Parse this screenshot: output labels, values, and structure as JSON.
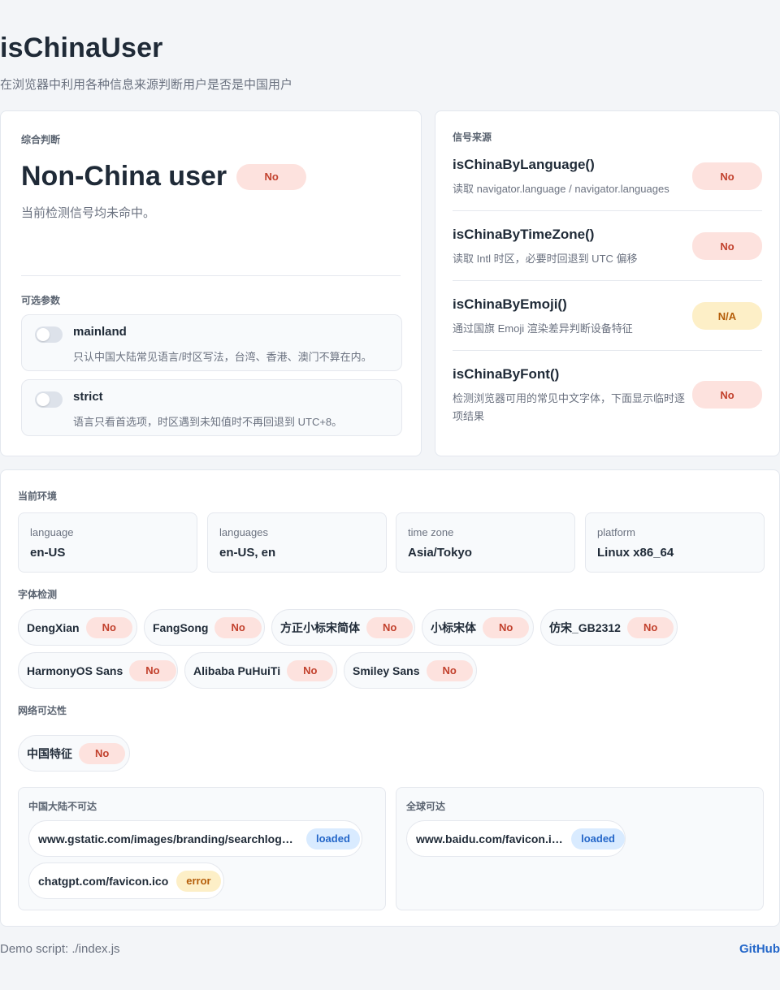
{
  "header": {
    "title": "isChinaUser",
    "subtitle": "在浏览器中利用各种信息来源判断用户是否是中国用户"
  },
  "verdict": {
    "section_title": "综合判断",
    "title": "Non-China user",
    "badge": "No",
    "description": "当前检测信号均未命中。",
    "options_title": "可选参数",
    "options": [
      {
        "name": "mainland",
        "enabled": false,
        "description": "只认中国大陆常见语言/时区写法，台湾、香港、澳门不算在内。"
      },
      {
        "name": "strict",
        "enabled": false,
        "description": "语言只看首选项，时区遇到未知值时不再回退到 UTC+8。"
      }
    ]
  },
  "signals": {
    "section_title": "信号来源",
    "items": [
      {
        "name": "isChinaByLanguage()",
        "description": "读取 navigator.language / navigator.languages",
        "badge": "No"
      },
      {
        "name": "isChinaByTimeZone()",
        "description": "读取 Intl 时区，必要时回退到 UTC 偏移",
        "badge": "No"
      },
      {
        "name": "isChinaByEmoji()",
        "description": "通过国旗 Emoji 渲染差异判断设备特征",
        "badge": "N/A"
      },
      {
        "name": "isChinaByFont()",
        "description": "检测浏览器可用的常见中文字体，下面显示临时逐项结果",
        "badge": "No"
      }
    ]
  },
  "environment": {
    "section_title": "当前环境",
    "fields": [
      {
        "key": "language",
        "value": "en-US"
      },
      {
        "key": "languages",
        "value": "en-US, en"
      },
      {
        "key": "time zone",
        "value": "Asia/Tokyo"
      },
      {
        "key": "platform",
        "value": "Linux x86_64"
      }
    ],
    "fonts_title": "字体检测",
    "fonts": [
      {
        "name": "DengXian",
        "badge": "No"
      },
      {
        "name": "FangSong",
        "badge": "No"
      },
      {
        "name": "方正小标宋简体",
        "badge": "No"
      },
      {
        "name": "小标宋体",
        "badge": "No"
      },
      {
        "name": "仿宋_GB2312",
        "badge": "No"
      },
      {
        "name": "HarmonyOS Sans",
        "badge": "No"
      },
      {
        "name": "Alibaba PuHuiTi",
        "badge": "No"
      },
      {
        "name": "Smiley Sans",
        "badge": "No"
      }
    ],
    "network_title": "网络可达性",
    "network_feature": {
      "name": "中国特征",
      "badge": "No"
    },
    "blocked": {
      "title": "中国大陆不可达",
      "items": [
        {
          "url": "www.gstatic.com/images/branding/searchlogo/…",
          "status": "loaded"
        },
        {
          "url": "chatgpt.com/favicon.ico",
          "status": "error"
        }
      ]
    },
    "global": {
      "title": "全球可达",
      "items": [
        {
          "url": "www.baidu.com/favicon.ico",
          "status": "loaded"
        }
      ]
    }
  },
  "footer": {
    "script": "Demo script: ./index.js",
    "link": "GitHub"
  }
}
